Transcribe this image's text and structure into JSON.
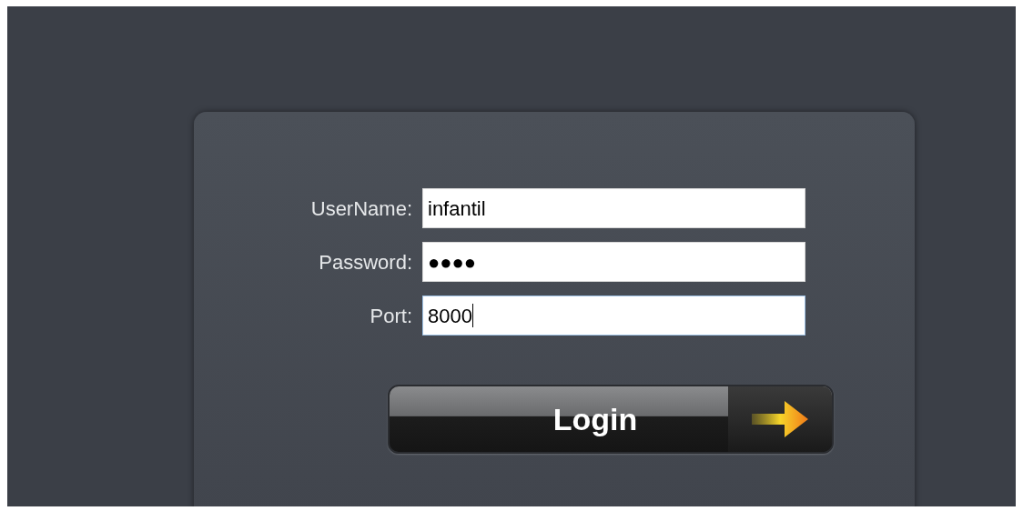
{
  "login_form": {
    "fields": [
      {
        "label": "UserName:",
        "value": "infantil",
        "focused": false
      },
      {
        "label": "Password:",
        "value": "●●●●",
        "focused": false
      },
      {
        "label": "Port:",
        "value": "8000",
        "focused": true
      }
    ],
    "login_button": {
      "label": "Login"
    }
  }
}
